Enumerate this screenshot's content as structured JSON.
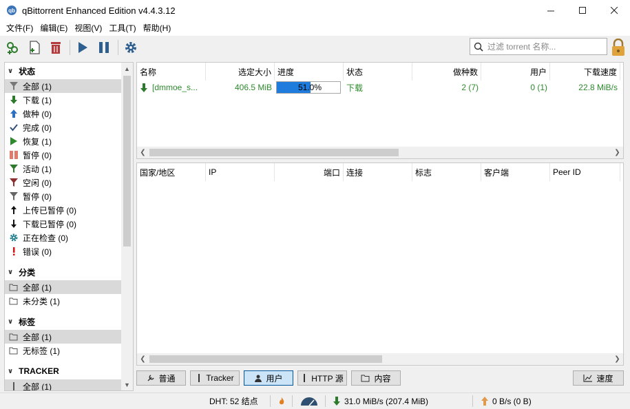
{
  "window": {
    "title": "qBittorrent Enhanced Edition v4.4.3.12",
    "app_icon": "qb"
  },
  "menu": [
    "文件(F)",
    "编辑(E)",
    "视图(V)",
    "工具(T)",
    "帮助(H)"
  ],
  "search": {
    "placeholder": "过滤 torrent 名称..."
  },
  "sidebar": {
    "status_header": "状态",
    "status": [
      {
        "label": "全部 (1)",
        "icon": "filter-icon",
        "selected": true
      },
      {
        "label": "下载 (1)",
        "icon": "download-icon"
      },
      {
        "label": "做种 (0)",
        "icon": "upload-icon"
      },
      {
        "label": "完成 (0)",
        "icon": "checkmark-icon"
      },
      {
        "label": "恢复 (1)",
        "icon": "play-icon"
      },
      {
        "label": "暂停 (0)",
        "icon": "pause-icon"
      },
      {
        "label": "活动 (1)",
        "icon": "filter-active-icon"
      },
      {
        "label": "空闲 (0)",
        "icon": "filter-idle-icon"
      },
      {
        "label": "暂停 (0)",
        "icon": "filter-paused-icon"
      },
      {
        "label": "上传已暂停 (0)",
        "icon": "upload-paused-icon"
      },
      {
        "label": "下载已暂停 (0)",
        "icon": "download-paused-icon"
      },
      {
        "label": "正在检查 (0)",
        "icon": "checking-gear-icon"
      },
      {
        "label": "错误 (0)",
        "icon": "error-icon"
      }
    ],
    "category_header": "分类",
    "categories": [
      {
        "label": "全部 (1)",
        "selected": true
      },
      {
        "label": "未分类 (1)"
      }
    ],
    "tag_header": "标签",
    "tags": [
      {
        "label": "全部 (1)",
        "selected": true
      },
      {
        "label": "无标签 (1)"
      }
    ],
    "tracker_header": "TRACKER",
    "trackers": [
      {
        "label": "全部 (1)"
      }
    ]
  },
  "torrents": {
    "columns": [
      "名称",
      "选定大小",
      "进度",
      "状态",
      "做种数",
      "用户",
      "下载速度"
    ],
    "rows": [
      {
        "name": "[dmmoe_s...",
        "size": "406.5 MiB",
        "progress": 0.51,
        "progress_text": "51.0%",
        "status": "下载",
        "seeds": "2 (7)",
        "peers": "0 (1)",
        "dlspeed": "22.8 MiB/s"
      }
    ]
  },
  "peers": {
    "columns": [
      "国家/地区",
      "IP",
      "端口",
      "连接",
      "标志",
      "客户端",
      "Peer ID"
    ]
  },
  "tabs": [
    {
      "label": "普通",
      "icon": "general-icon"
    },
    {
      "label": "Tracker",
      "icon": "tracker-icon"
    },
    {
      "label": "用户",
      "icon": "peers-icon",
      "active": true
    },
    {
      "label": "HTTP 源",
      "icon": "http-icon"
    },
    {
      "label": "内容",
      "icon": "folder-icon"
    }
  ],
  "speed_tab": "速度",
  "statusbar": {
    "dht": "DHT:  52 结点",
    "download": "31.0 MiB/s (207.4 MiB)",
    "upload": "0 B/s (0 B)"
  },
  "colors": {
    "accent": "#1f7cdc",
    "download_green": "#2d8a2d",
    "selected_bg": "#d9d9d9"
  }
}
